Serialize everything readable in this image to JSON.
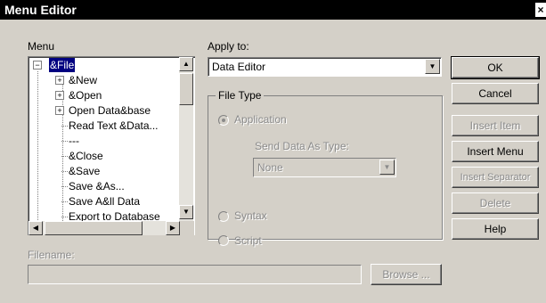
{
  "window": {
    "title": "Menu Editor",
    "close_glyph": "×"
  },
  "menu_label": "Menu",
  "tree": {
    "items": [
      {
        "label": "&File",
        "expander": "−",
        "selected": true
      },
      {
        "label": "&New",
        "expander": "+"
      },
      {
        "label": "&Open",
        "expander": "+"
      },
      {
        "label": "Open Data&base",
        "expander": "+"
      },
      {
        "label": "Read Text &Data..."
      },
      {
        "label": "---"
      },
      {
        "label": "&Close"
      },
      {
        "label": "&Save"
      },
      {
        "label": "Save &As..."
      },
      {
        "label": "Save A&ll Data"
      },
      {
        "label": "Export to Database"
      }
    ]
  },
  "apply_to": {
    "label": "Apply to:",
    "value": "Data Editor"
  },
  "file_type": {
    "label": "File Type",
    "application_label": "Application",
    "send_data_label": "Send Data As Type:",
    "send_data_value": "None",
    "syntax_label": "Syntax",
    "script_label": "Script",
    "selected": "Application"
  },
  "buttons": {
    "ok": "OK",
    "cancel": "Cancel",
    "insert_item": "Insert Item",
    "insert_menu": "Insert Menu",
    "insert_separator": "Insert Separator",
    "delete": "Delete",
    "help": "Help"
  },
  "filename": {
    "label": "Filename:",
    "value": ""
  },
  "browse_label": "Browse ...",
  "icons": {
    "dropdown": "▼",
    "scroll_up": "▲",
    "scroll_down": "▼",
    "scroll_left": "◀",
    "scroll_right": "▶"
  }
}
